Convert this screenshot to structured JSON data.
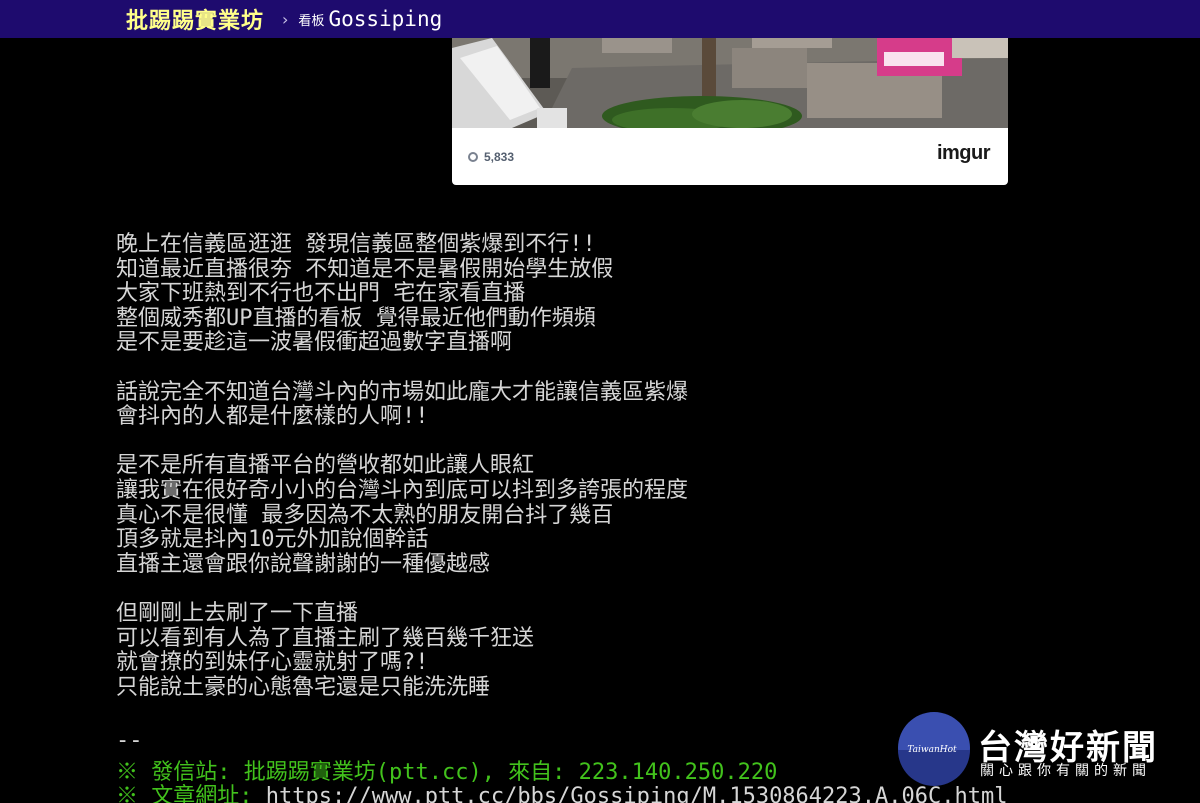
{
  "header": {
    "site_name": "批踢踢實業坊",
    "separator": "›",
    "board_label": "看板",
    "board_name": "Gossiping"
  },
  "embed": {
    "views": "5,833",
    "logo": "imgur"
  },
  "article": {
    "paragraphs": [
      [
        "晚上在信義區逛逛 發現信義區整個紫爆到不行!!",
        "知道最近直播很夯 不知道是不是暑假開始學生放假",
        "大家下班熱到不行也不出門 宅在家看直播",
        "整個威秀都UP直播的看板 覺得最近他們動作頻頻",
        "是不是要趁這一波暑假衝超過數字直播啊"
      ],
      [
        "話說完全不知道台灣斗內的市場如此龐大才能讓信義區紫爆",
        "會抖內的人都是什麼樣的人啊!!"
      ],
      [
        "是不是所有直播平台的營收都如此讓人眼紅",
        "讓我實在很好奇小小的台灣斗內到底可以抖到多誇張的程度",
        "真心不是很懂 最多因為不太熟的朋友開台抖了幾百",
        "頂多就是抖內10元外加說個幹話",
        "直播主還會跟你說聲謝謝的一種優越感"
      ],
      [
        "但剛剛上去刷了一下直播",
        "可以看到有人為了直播主刷了幾百幾千狂送",
        "就會撩的到妹仔心靈就射了嗎?!",
        "只能說土豪的心態魯宅還是只能洗洗睡"
      ]
    ],
    "signature_dash": "--",
    "origin_line": "※ 發信站: 批踢踢實業坊(ptt.cc), 來自: 223.140.250.220",
    "url_label": "※ 文章網址: ",
    "url": "https://www.ptt.cc/bbs/Gossiping/M.1530864223.A.06C.html"
  },
  "watermark": {
    "badge_text": "TaiwanHot",
    "title": "台灣好新聞",
    "subtitle": "關心跟你有關的新聞"
  },
  "colors": {
    "header_bg": "#1e0b6e",
    "site_name": "#ffff8a",
    "body_text": "#d6d6d6",
    "sys_green": "#42c21c",
    "badge_blue": "#3a4fb0"
  }
}
